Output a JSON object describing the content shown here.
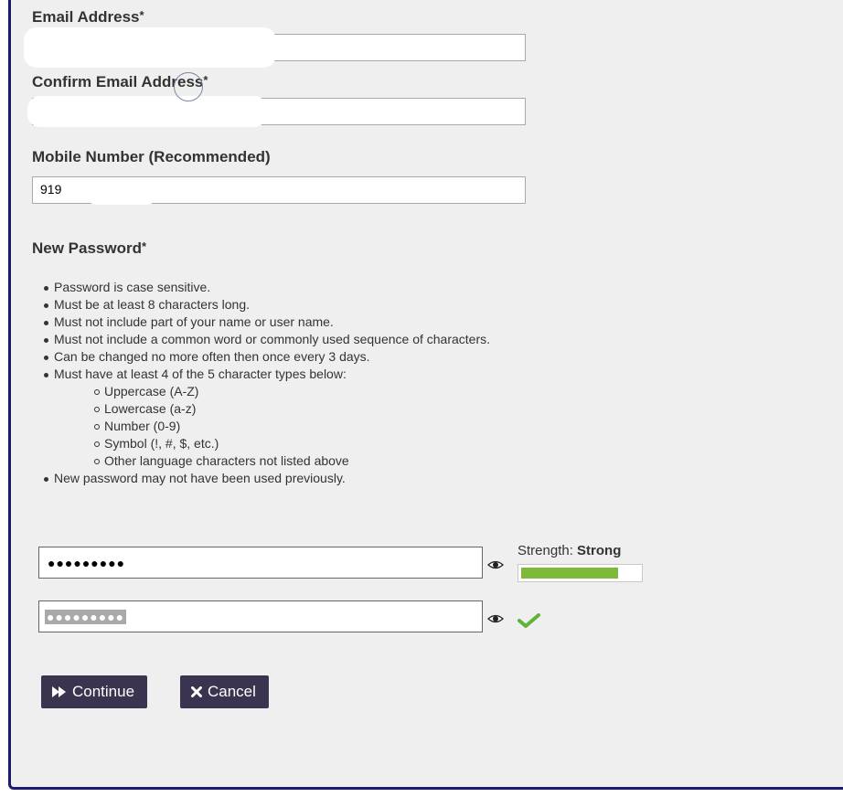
{
  "form": {
    "email": {
      "label": "Email Address",
      "required_mark": "*",
      "value": ""
    },
    "confirm_email": {
      "label": "Confirm Email Address",
      "required_mark": "*",
      "value": ""
    },
    "mobile": {
      "label": "Mobile Number (Recommended)",
      "value": "919"
    }
  },
  "password_section": {
    "heading": "New Password",
    "required_mark": "*",
    "rules": [
      "Password is case sensitive.",
      "Must be at least 8 characters long.",
      "Must not include part of your name or user name.",
      "Must not include a common word or commonly used sequence of characters.",
      "Can be changed no more often then once every 3 days.",
      "Must have at least 4 of the 5 character types below:"
    ],
    "char_types": [
      "Uppercase (A-Z)",
      "Lowercase (a-z)",
      "Number (0-9)",
      "Symbol (!, #, $, etc.)",
      "Other language characters not listed above"
    ],
    "last_rule": "New password may not have been used previously.",
    "new_password_masked": "●●●●●●●●●",
    "confirm_password_masked": "●●●●●●●●●",
    "strength_prefix": "Strength:",
    "strength_value": "Strong",
    "strength_level": 0.82,
    "match_status": "match"
  },
  "buttons": {
    "continue_label": "Continue",
    "cancel_label": "Cancel"
  },
  "colors": {
    "border_accent": "#1a1a6e",
    "button_bg": "#3a3450",
    "strength_fill": "#7db93a",
    "check": "#5fb336"
  },
  "icons": {
    "show_password": "eye-icon",
    "match": "checkmark-icon",
    "continue": "fast-forward-icon",
    "cancel": "x-icon"
  }
}
